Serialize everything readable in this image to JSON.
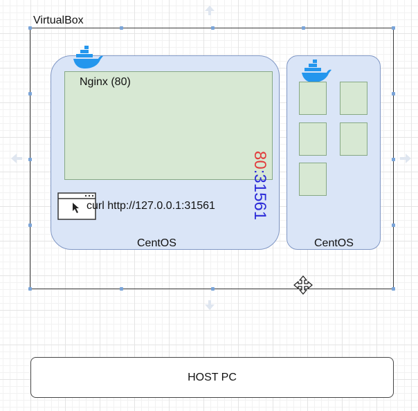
{
  "virtualbox": {
    "label": "VirtualBox"
  },
  "centos_main": {
    "label": "CentOS",
    "nginx_label": "Nginx (80)",
    "port_container": "80",
    "port_separator": ":",
    "port_host": "31561",
    "curl_command": "curl http://127.0.0.1:31561"
  },
  "centos_side": {
    "label": "CentOS",
    "containers": 5
  },
  "host": {
    "label": "HOST PC"
  },
  "icons": [
    "docker-whale-icon",
    "browser-window-icon",
    "move-cursor-icon"
  ],
  "colors": {
    "vm_fill": "#dae5f7",
    "container_fill": "#d7e8d3",
    "port_container": "#e23c3c",
    "port_host": "#2b2bd8",
    "docker_blue": "#2496ed"
  }
}
